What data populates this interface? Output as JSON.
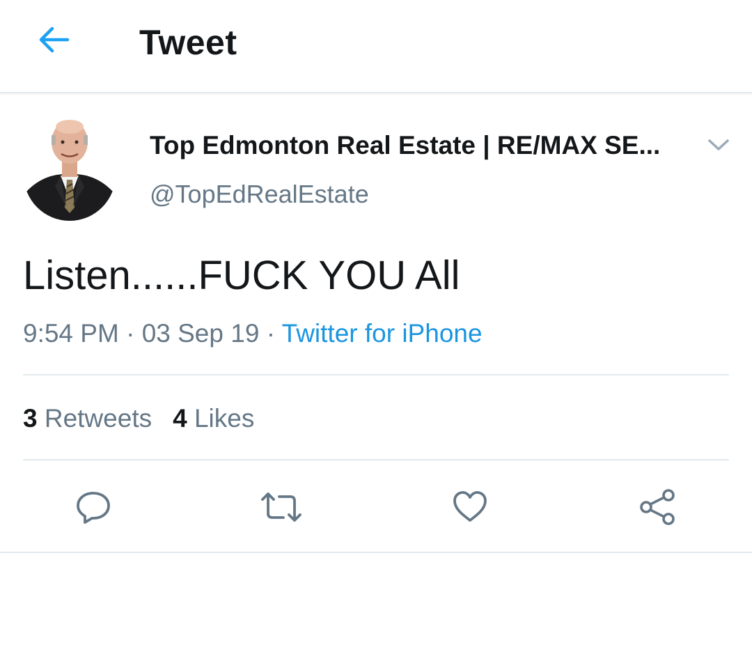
{
  "header": {
    "title": "Tweet",
    "back_icon": "arrow-left-icon"
  },
  "tweet": {
    "display_name": "Top Edmonton Real Estate | RE/MAX SE...",
    "handle": "@TopEdRealEstate",
    "text": "Listen......FUCK YOU All",
    "time": "9:54 PM",
    "separator": "·",
    "date": "03 Sep 19",
    "source": "Twitter for iPhone"
  },
  "stats": {
    "retweets_count": "3",
    "retweets_label": "Retweets",
    "likes_count": "4",
    "likes_label": "Likes"
  },
  "actions": [
    "reply-icon",
    "retweet-icon",
    "like-icon",
    "share-icon"
  ],
  "colors": {
    "accent": "#1da1f2",
    "link": "#1b95e0",
    "secondary_text": "#657786",
    "divider": "#e1e8ed",
    "icon": "#657786"
  }
}
